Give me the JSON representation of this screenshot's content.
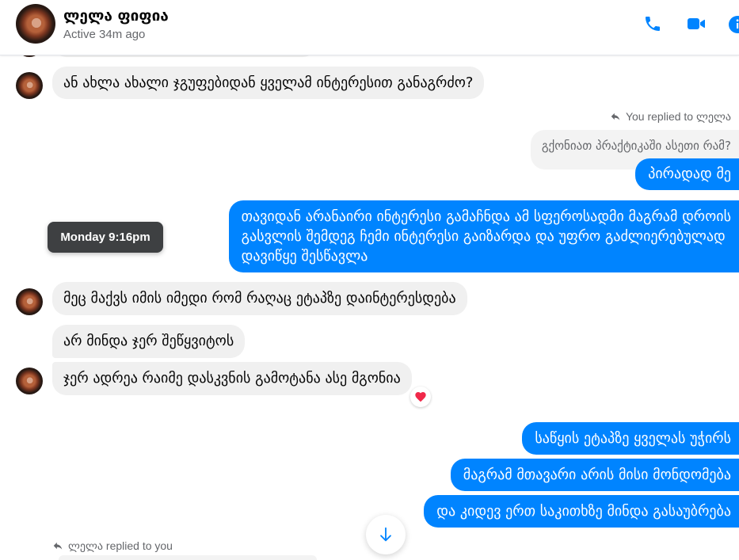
{
  "header": {
    "contact_name": "ლელა ფიფია",
    "status": "Active 34m ago",
    "call_icon": "phone-icon",
    "video_icon": "video-camera-icon",
    "info_icon": "info-icon"
  },
  "colors": {
    "accent": "#0084ff",
    "incoming_bubble": "#f0f0f0",
    "quoted_bubble": "#f3f3f3",
    "secondary_text": "#65676b",
    "primary_text": "#050505",
    "tooltip_bg": "#3e4042",
    "reaction_heart": "#f02849"
  },
  "messages": [
    {
      "incoming": true,
      "text": "ან ახლა ახალი ჯგუფებიდან ყველამ ინტერესით განაგრძო?"
    },
    {
      "incoming": false,
      "reply_label": "You replied to ლელა",
      "reply_icon": "reply-arrow-icon",
      "quoted_text": "გქონიათ პრაქტიკაში ასეთი რამ?",
      "text": "პირადად მე"
    },
    {
      "incoming": false,
      "lines": [
        "თავიდან არანაირი ინტერესი გამაჩნდა ამ სფეროსადმი მაგრამ დროის",
        "გასვლის შემდეგ ჩემი ინტერესი გაიზარდა და უფრო გაძლიერებულად",
        "დავიწყე შესწავლა"
      ],
      "hover_tooltip": "Monday 9:16pm"
    },
    {
      "incoming": true,
      "text": "მეც მაქვს იმის იმედი რომ რაღაც ეტაპზე დაინტერესდება"
    },
    {
      "incoming": true,
      "text": "არ მინდა ჯერ შეწყვიტოს"
    },
    {
      "incoming": true,
      "text": "ჯერ ადრეა რაიმე დასკვნის გამოტანა ასე მგონია",
      "reaction_icon": "heart-icon"
    },
    {
      "incoming": false,
      "text": "საწყის ეტაპზე ყველას უჭირს"
    },
    {
      "incoming": false,
      "text": "მაგრამ მთავარი არის მისი მონდომება"
    },
    {
      "incoming": false,
      "text": "და კიდევ ერთ საკითხზე მინდა გასაუბრება"
    },
    {
      "incoming": true,
      "reply_label": "ლელა replied to you",
      "reply_icon": "reply-arrow-icon"
    }
  ],
  "scroll_button_icon": "arrow-down-icon"
}
